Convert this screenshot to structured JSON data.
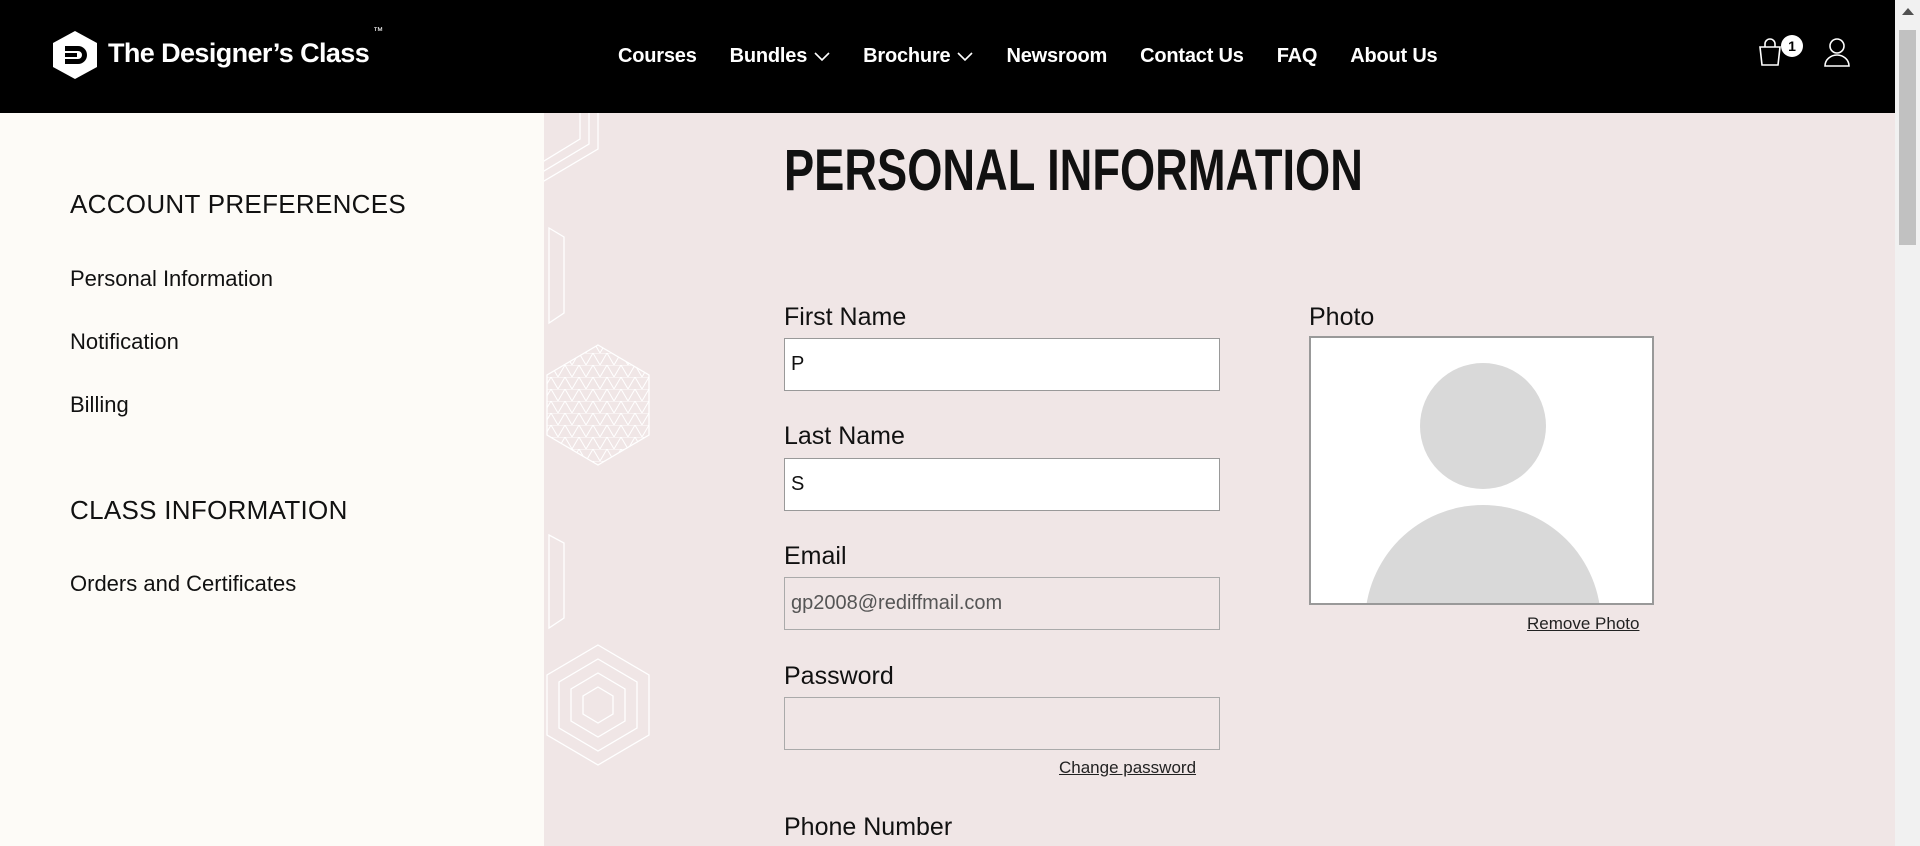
{
  "brand": {
    "name": "The Designer’s Class",
    "tm": "™"
  },
  "nav": {
    "items": [
      {
        "label": "Courses",
        "dropdown": false
      },
      {
        "label": "Bundles",
        "dropdown": true
      },
      {
        "label": "Brochure",
        "dropdown": true
      },
      {
        "label": "Newsroom",
        "dropdown": false
      },
      {
        "label": "Contact Us",
        "dropdown": false
      },
      {
        "label": "FAQ",
        "dropdown": false
      },
      {
        "label": "About Us",
        "dropdown": false
      }
    ]
  },
  "header_icons": {
    "cart_icon": "shopping-bag-icon",
    "cart_count": "1",
    "user_icon": "user-icon"
  },
  "sidebar": {
    "account_heading": "ACCOUNT PREFERENCES",
    "account_links": [
      "Personal Information",
      "Notification",
      "Billing"
    ],
    "class_heading": "CLASS INFORMATION",
    "class_links": [
      "Orders and Certificates"
    ]
  },
  "main": {
    "title": "PERSONAL INFORMATION",
    "first_name": {
      "label": "First Name",
      "value": "P"
    },
    "last_name": {
      "label": "Last Name",
      "value": "S"
    },
    "email": {
      "label": "Email",
      "value": "gp2008@rediffmail.com"
    },
    "password": {
      "label": "Password",
      "value": "",
      "change_link": "Change password"
    },
    "phone": {
      "label": "Phone Number"
    },
    "photo": {
      "label": "Photo",
      "remove_link": "Remove Photo"
    }
  },
  "colors": {
    "header_bg": "#000000",
    "sidebar_bg": "#fdfbf7",
    "main_bg": "#f0e6e6"
  }
}
